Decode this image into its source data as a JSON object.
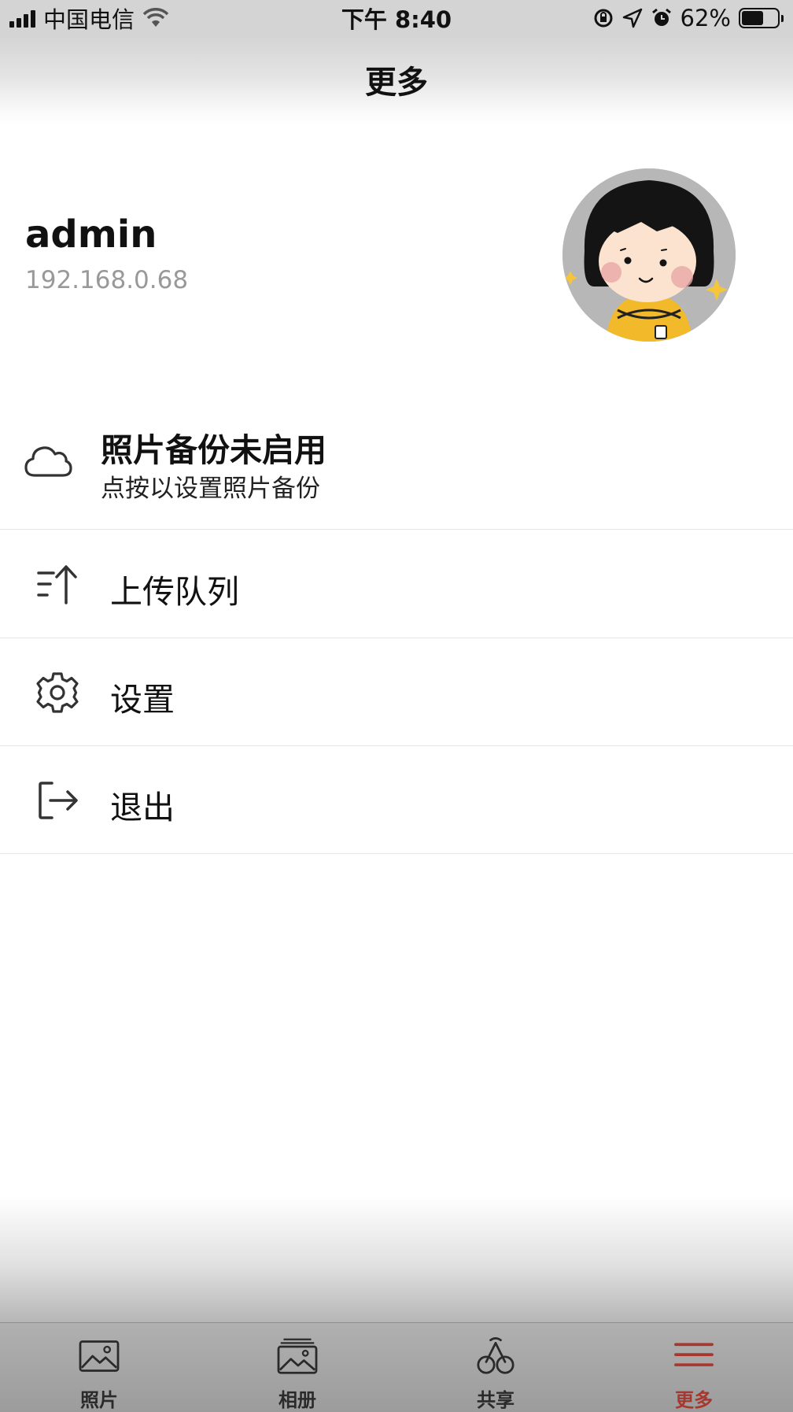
{
  "status_bar": {
    "carrier": "中国电信",
    "time": "下午 8:40",
    "battery_percent": "62%",
    "battery_level": 0.62,
    "icons": [
      "signal-icon",
      "wifi-icon",
      "rotation-lock-icon",
      "location-icon",
      "alarm-icon",
      "battery-icon"
    ]
  },
  "header": {
    "title": "更多"
  },
  "profile": {
    "username": "admin",
    "server": "192.168.0.68",
    "avatar_icon": "avatar-cartoon-girl"
  },
  "backup": {
    "title": "照片备份未启用",
    "subtitle": "点按以设置照片备份",
    "icon": "cloud-icon"
  },
  "menu": {
    "items": [
      {
        "label": "上传队列",
        "icon": "upload-queue-icon"
      },
      {
        "label": "设置",
        "icon": "gear-icon"
      },
      {
        "label": "退出",
        "icon": "logout-icon"
      }
    ]
  },
  "tabs": {
    "items": [
      {
        "label": "照片",
        "icon": "photo-icon",
        "active": false
      },
      {
        "label": "相册",
        "icon": "album-icon",
        "active": false
      },
      {
        "label": "共享",
        "icon": "share-icon",
        "active": false
      },
      {
        "label": "更多",
        "icon": "menu-icon",
        "active": true
      }
    ]
  },
  "colors": {
    "accent": "#a8382f",
    "tab_bar": "#a3a3a3",
    "secondary_text": "#999999",
    "divider": "#e6e6e6"
  }
}
